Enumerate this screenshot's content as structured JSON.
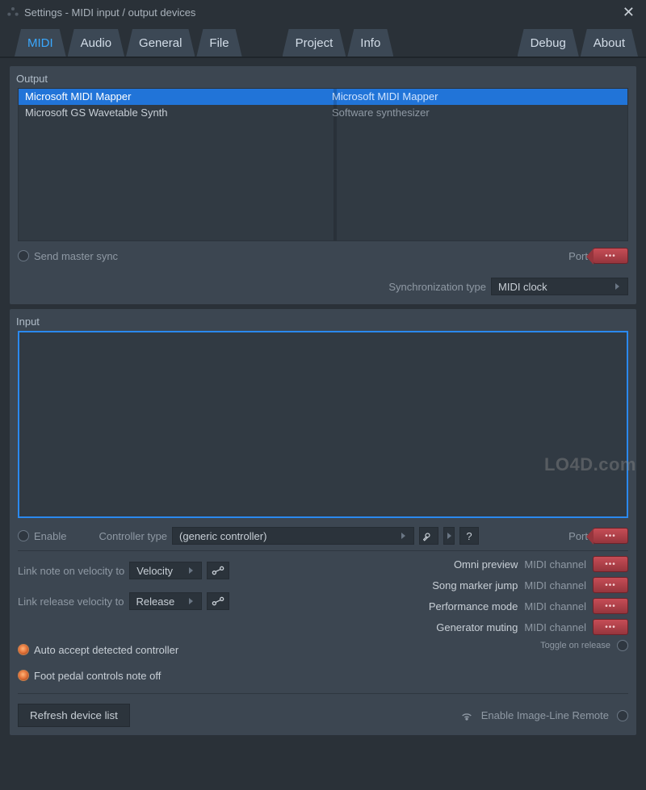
{
  "window": {
    "title": "Settings - MIDI input / output devices"
  },
  "tabs": {
    "items": [
      "MIDI",
      "Audio",
      "General",
      "File",
      "Project",
      "Info",
      "Debug",
      "About"
    ],
    "active": 0
  },
  "output": {
    "title": "Output",
    "devices": [
      {
        "name": "Microsoft MIDI Mapper",
        "desc": "Microsoft MIDI Mapper",
        "selected": true
      },
      {
        "name": "Microsoft GS Wavetable Synth",
        "desc": "Software synthesizer",
        "selected": false
      }
    ],
    "send_master_sync_label": "Send master sync",
    "port_label": "Port",
    "sync_type_label": "Synchronization type",
    "sync_type_value": "MIDI clock"
  },
  "input": {
    "title": "Input",
    "enable_label": "Enable",
    "controller_type_label": "Controller type",
    "controller_type_value": "(generic controller)",
    "port_label": "Port",
    "link_note_on_label": "Link note on velocity to",
    "link_note_on_value": "Velocity",
    "link_release_label": "Link release velocity to",
    "link_release_value": "Release",
    "auto_accept_label": "Auto accept detected controller",
    "foot_pedal_label": "Foot pedal controls note off",
    "right_items": [
      {
        "name": "Omni preview",
        "chan": "MIDI channel"
      },
      {
        "name": "Song marker jump",
        "chan": "MIDI channel"
      },
      {
        "name": "Performance mode",
        "chan": "MIDI channel"
      },
      {
        "name": "Generator muting",
        "chan": "MIDI channel"
      }
    ],
    "toggle_on_release_label": "Toggle on release"
  },
  "footer": {
    "refresh_label": "Refresh device list",
    "enable_remote_label": "Enable Image-Line Remote"
  },
  "watermark": "LO4D.com",
  "help_q": "?"
}
